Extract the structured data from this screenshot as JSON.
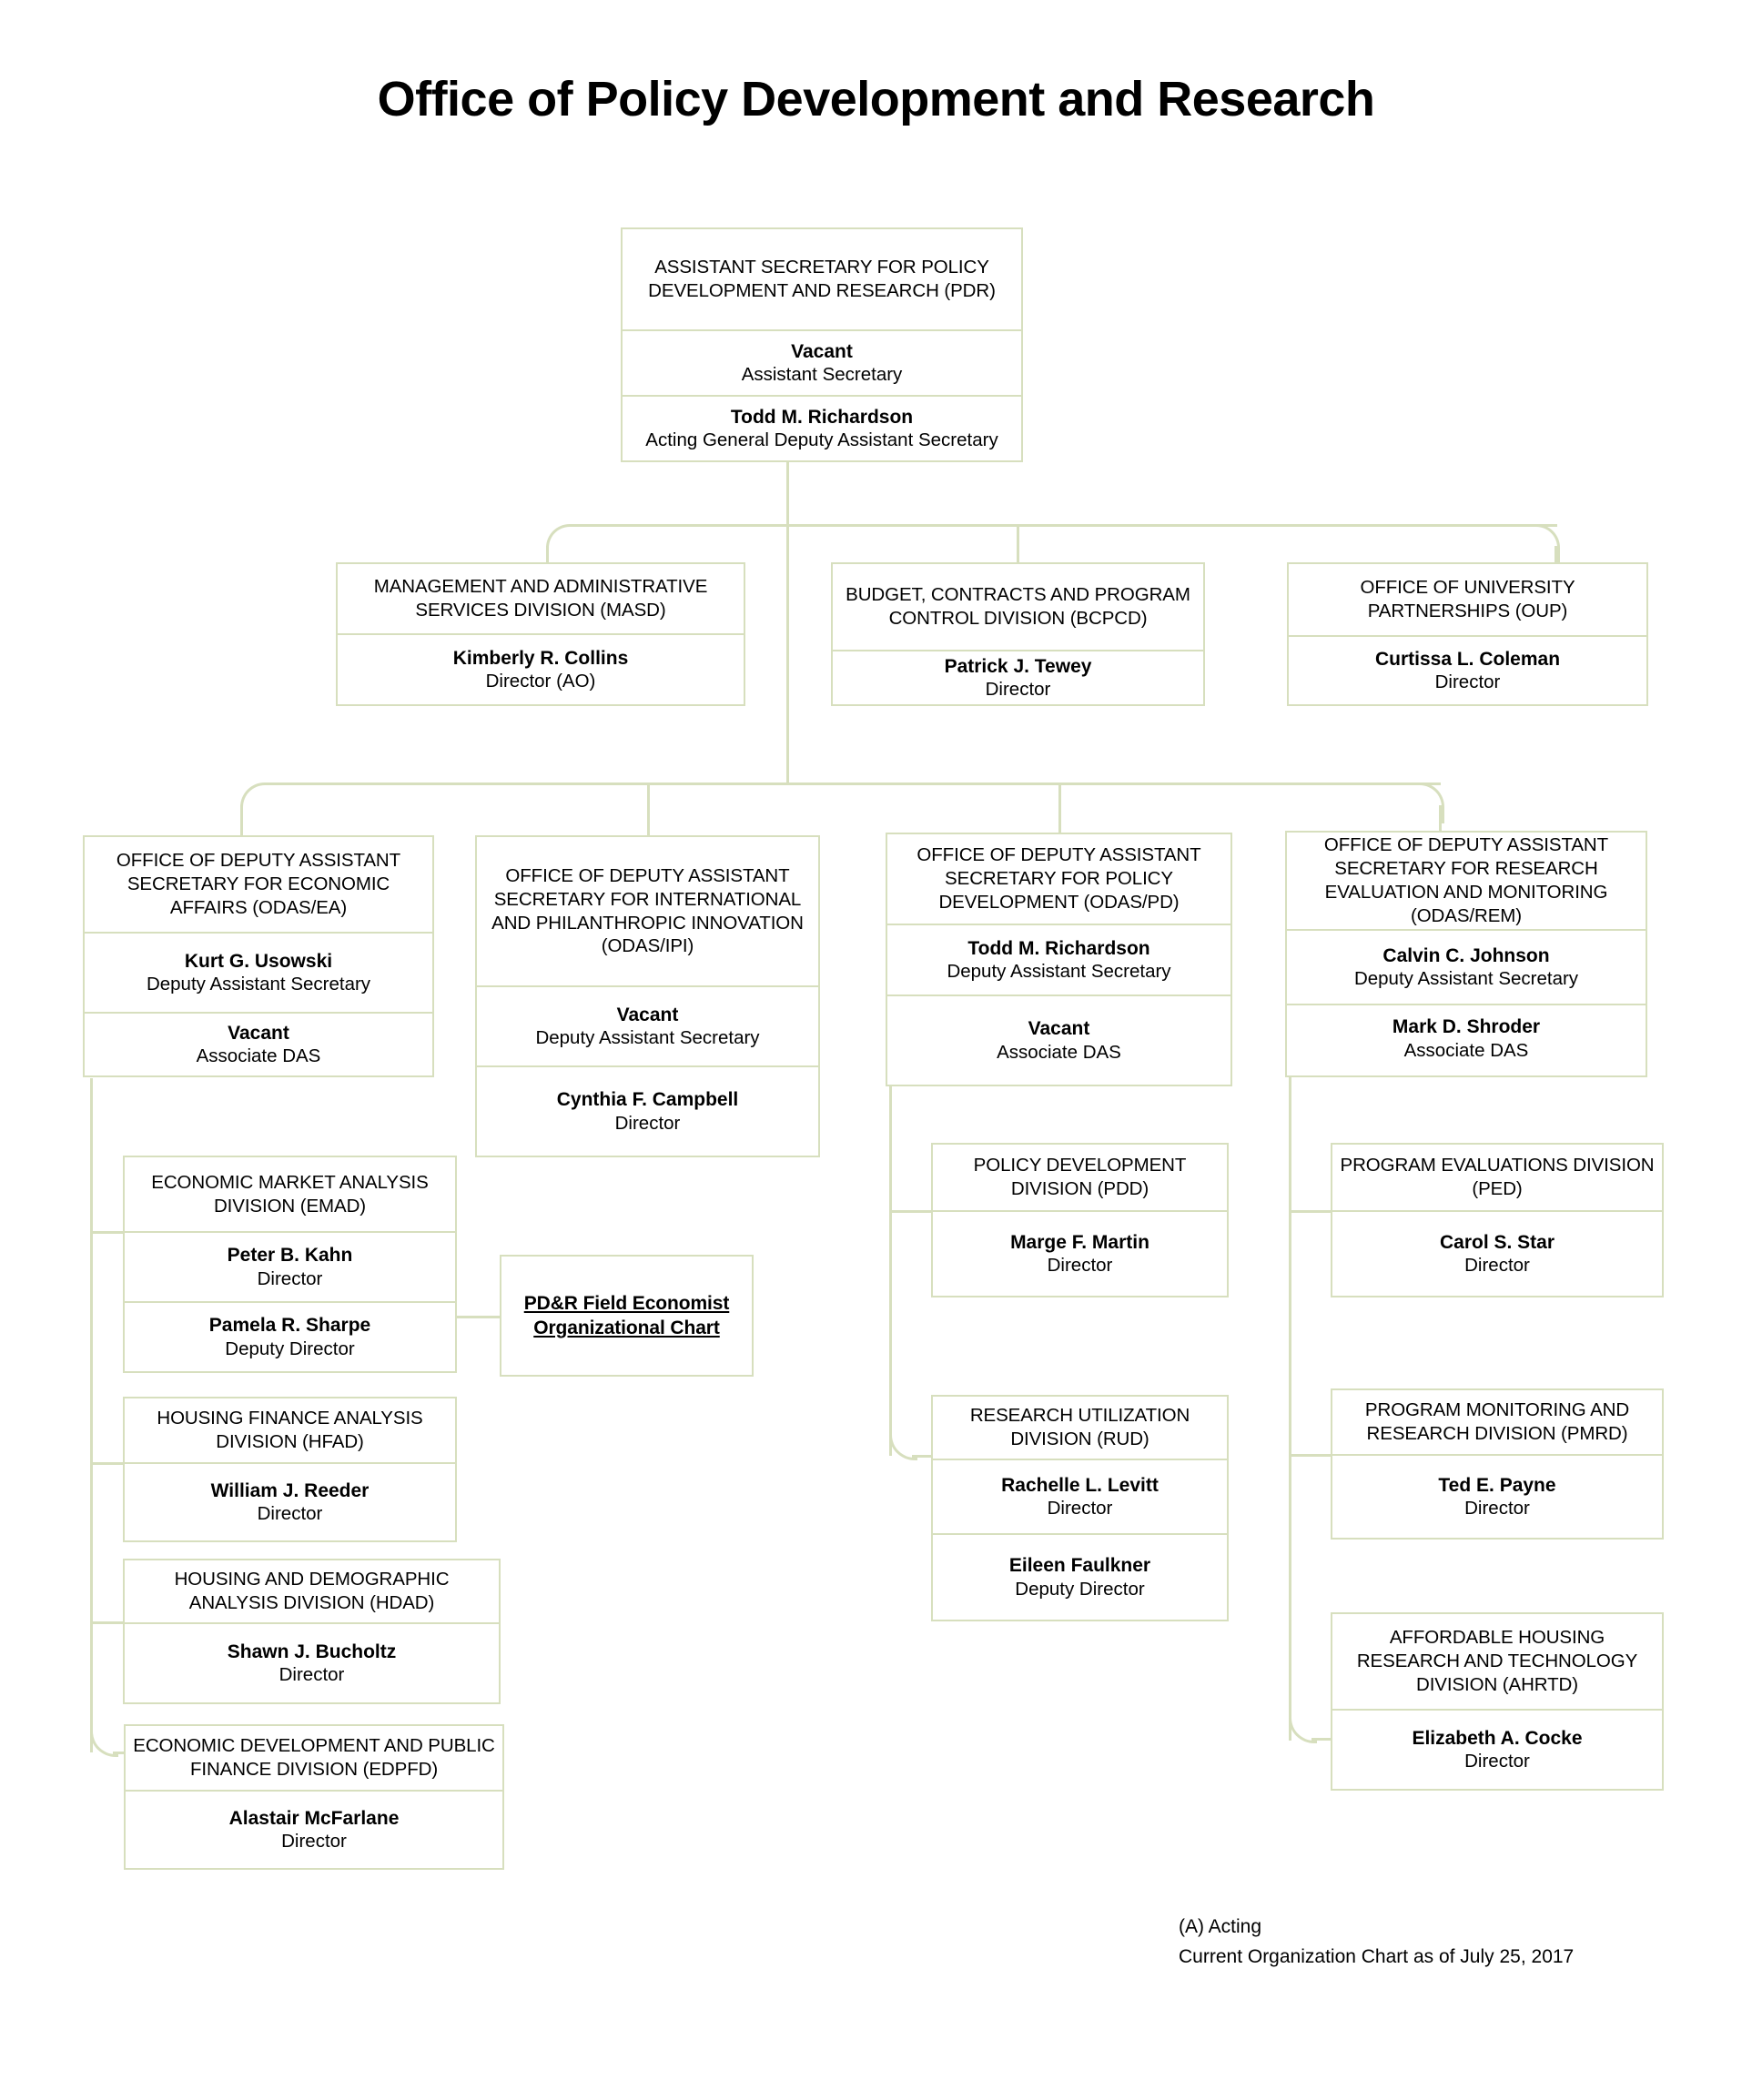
{
  "title": "Office of Policy Development and Research",
  "colors": {
    "border": "#d7dfbe",
    "connector": "#d7dfbe",
    "background": "#ffffff",
    "text": "#000000"
  },
  "root": {
    "unit": "ASSISTANT SECRETARY FOR POLICY DEVELOPMENT AND RESEARCH (PDR)",
    "people": [
      {
        "name": "Vacant",
        "role": "Assistant Secretary"
      },
      {
        "name": "Todd M. Richardson",
        "role": "Acting General Deputy Assistant Secretary"
      }
    ]
  },
  "level2": [
    {
      "unit": "MANAGEMENT AND ADMINISTRATIVE SERVICES DIVISION (MASD)",
      "people": [
        {
          "name": "Kimberly R. Collins",
          "role": "Director (AO)"
        }
      ]
    },
    {
      "unit": "BUDGET, CONTRACTS AND PROGRAM CONTROL DIVISION (BCPCD)",
      "people": [
        {
          "name": "Patrick J. Tewey",
          "role": "Director"
        }
      ]
    },
    {
      "unit": "OFFICE OF UNIVERSITY PARTNERSHIPS (OUP)",
      "people": [
        {
          "name": "Curtissa L. Coleman",
          "role": "Director"
        }
      ]
    }
  ],
  "level3": [
    {
      "key": "odas-ea",
      "unit": "OFFICE OF DEPUTY ASSISTANT SECRETARY FOR ECONOMIC AFFAIRS (ODAS/EA)",
      "people": [
        {
          "name": "Kurt G. Usowski",
          "role": "Deputy Assistant Secretary"
        },
        {
          "name": "Vacant",
          "role": "Associate DAS"
        }
      ]
    },
    {
      "key": "odas-ipi",
      "unit": "OFFICE OF DEPUTY ASSISTANT SECRETARY FOR INTERNATIONAL AND PHILANTHROPIC INNOVATION (ODAS/IPI)",
      "people": [
        {
          "name": "Vacant",
          "role": "Deputy Assistant Secretary"
        },
        {
          "name": "Cynthia F. Campbell",
          "role": "Director"
        }
      ]
    },
    {
      "key": "odas-pd",
      "unit": "OFFICE OF DEPUTY ASSISTANT SECRETARY FOR POLICY DEVELOPMENT (ODAS/PD)",
      "people": [
        {
          "name": "Todd M. Richardson",
          "role": "Deputy Assistant Secretary"
        },
        {
          "name": "Vacant",
          "role": "Associate DAS"
        }
      ]
    },
    {
      "key": "odas-rem",
      "unit": "OFFICE OF DEPUTY ASSISTANT SECRETARY FOR RESEARCH EVALUATION AND MONITORING (ODAS/REM)",
      "people": [
        {
          "name": "Calvin C. Johnson",
          "role": "Deputy Assistant Secretary"
        },
        {
          "name": "Mark D. Shroder",
          "role": "Associate DAS"
        }
      ]
    }
  ],
  "ea_divisions": [
    {
      "unit": "ECONOMIC MARKET ANALYSIS DIVISION (EMAD)",
      "people": [
        {
          "name": "Peter B. Kahn",
          "role": "Director"
        },
        {
          "name": "Pamela R. Sharpe",
          "role": "Deputy Director"
        }
      ]
    },
    {
      "unit": "HOUSING FINANCE ANALYSIS DIVISION (HFAD)",
      "people": [
        {
          "name": "William J. Reeder",
          "role": "Director"
        }
      ]
    },
    {
      "unit": "HOUSING AND DEMOGRAPHIC ANALYSIS DIVISION (HDAD)",
      "people": [
        {
          "name": "Shawn J. Bucholtz",
          "role": "Director"
        }
      ]
    },
    {
      "unit": "ECONOMIC DEVELOPMENT AND PUBLIC FINANCE DIVISION (EDPFD)",
      "people": [
        {
          "name": "Alastair McFarlane",
          "role": "Director"
        }
      ]
    }
  ],
  "field_economist_link": {
    "line1": "PD&R Field Economist",
    "line2": "Organizational Chart"
  },
  "pd_divisions": [
    {
      "unit": "POLICY DEVELOPMENT DIVISION (PDD)",
      "people": [
        {
          "name": "Marge F. Martin",
          "role": "Director"
        }
      ]
    },
    {
      "unit": "RESEARCH UTILIZATION DIVISION (RUD)",
      "people": [
        {
          "name": "Rachelle L. Levitt",
          "role": "Director"
        },
        {
          "name": "Eileen Faulkner",
          "role": "Deputy Director"
        }
      ]
    }
  ],
  "rem_divisions": [
    {
      "unit": "PROGRAM EVALUATIONS DIVISION (PED)",
      "people": [
        {
          "name": "Carol S. Star",
          "role": "Director"
        }
      ]
    },
    {
      "unit": "PROGRAM MONITORING AND RESEARCH DIVISION (PMRD)",
      "people": [
        {
          "name": "Ted E. Payne",
          "role": "Director"
        }
      ]
    },
    {
      "unit": "AFFORDABLE HOUSING RESEARCH AND TECHNOLOGY DIVISION (AHRTD)",
      "people": [
        {
          "name": "Elizabeth A. Cocke",
          "role": "Director"
        }
      ]
    }
  ],
  "footer": {
    "acting_note": "(A) Acting",
    "as_of": "Current Organization Chart as of July 25, 2017"
  }
}
